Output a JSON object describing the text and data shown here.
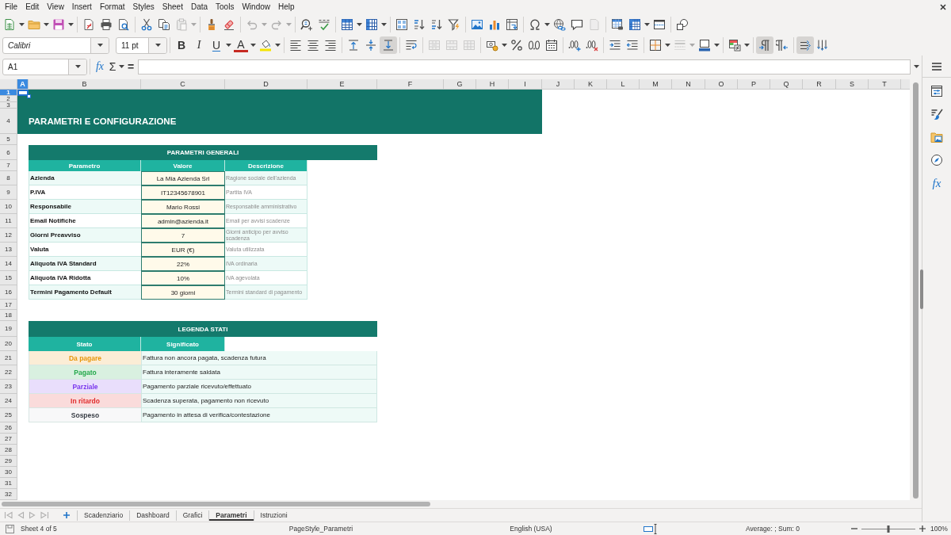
{
  "menu_bar": {
    "items": [
      "File",
      "Edit",
      "View",
      "Insert",
      "Format",
      "Styles",
      "Sheet",
      "Data",
      "Tools",
      "Window",
      "Help"
    ]
  },
  "standard_toolbar": {
    "groups": [
      {
        "items": [
          {
            "kind": "new",
            "disabled": false
          },
          {
            "kind": "caret",
            "disabled": false
          },
          {
            "kind": "open",
            "disabled": false
          },
          {
            "kind": "caret",
            "disabled": false
          },
          {
            "kind": "save",
            "disabled": false
          },
          {
            "kind": "caret",
            "disabled": false
          }
        ]
      },
      {
        "items": [
          {
            "kind": "export-pdf",
            "disabled": false
          },
          {
            "kind": "print",
            "disabled": false
          },
          {
            "kind": "print-preview",
            "disabled": false
          }
        ]
      },
      {
        "items": [
          {
            "kind": "cut",
            "disabled": false
          },
          {
            "kind": "copy",
            "disabled": false
          },
          {
            "kind": "paste",
            "disabled": true
          },
          {
            "kind": "caret",
            "disabled": true
          }
        ]
      },
      {
        "items": [
          {
            "kind": "clone-formatting",
            "disabled": false
          },
          {
            "kind": "clear-formatting",
            "disabled": false
          }
        ]
      },
      {
        "items": [
          {
            "kind": "undo",
            "disabled": true
          },
          {
            "kind": "caret",
            "disabled": true
          },
          {
            "kind": "redo",
            "disabled": true
          },
          {
            "kind": "caret",
            "disabled": true
          }
        ]
      },
      {
        "items": [
          {
            "kind": "find-replace",
            "disabled": false
          },
          {
            "kind": "spelling",
            "disabled": false
          }
        ]
      },
      {
        "items": [
          {
            "kind": "rows",
            "disabled": false
          },
          {
            "kind": "caret",
            "disabled": false
          },
          {
            "kind": "columns",
            "disabled": false
          },
          {
            "kind": "caret",
            "disabled": false
          }
        ]
      },
      {
        "items": [
          {
            "kind": "sort",
            "disabled": false
          },
          {
            "kind": "sort-ascending",
            "disabled": false
          },
          {
            "kind": "sort-descending",
            "disabled": false
          },
          {
            "kind": "autofilter",
            "disabled": false
          }
        ]
      },
      {
        "items": [
          {
            "kind": "image",
            "disabled": false
          },
          {
            "kind": "chart",
            "disabled": false
          },
          {
            "kind": "pivot-table",
            "disabled": false
          }
        ]
      },
      {
        "items": [
          {
            "kind": "special-character",
            "disabled": false
          },
          {
            "kind": "caret",
            "disabled": false
          },
          {
            "kind": "hyperlink",
            "disabled": false
          },
          {
            "kind": "comment",
            "disabled": false
          },
          {
            "kind": "header-footer",
            "disabled": true
          }
        ]
      },
      {
        "items": [
          {
            "kind": "print-area",
            "disabled": false
          },
          {
            "kind": "freeze",
            "disabled": false
          },
          {
            "kind": "caret",
            "disabled": false
          },
          {
            "kind": "split-window",
            "disabled": false
          }
        ]
      },
      {
        "items": [
          {
            "kind": "shapes",
            "disabled": false
          }
        ]
      }
    ]
  },
  "formatting_toolbar": {
    "font_name": "Calibri",
    "font_size": "11 pt",
    "groups": [
      {
        "items": [
          {
            "kind": "bold",
            "label": "B",
            "disabled": false,
            "pressed": false
          },
          {
            "kind": "italic",
            "label": "I",
            "disabled": false,
            "pressed": false
          },
          {
            "kind": "underline",
            "label": "U",
            "disabled": false,
            "pressed": false
          },
          {
            "kind": "caret",
            "disabled": false,
            "pressed": false
          },
          {
            "kind": "font-color",
            "label": "A",
            "disabled": false,
            "pressed": false
          },
          {
            "kind": "caret",
            "disabled": false,
            "pressed": false
          },
          {
            "kind": "highlight",
            "disabled": false,
            "pressed": false
          },
          {
            "kind": "caret",
            "disabled": false,
            "pressed": false
          }
        ]
      },
      {
        "items": [
          {
            "kind": "align-left",
            "disabled": false,
            "pressed": false
          },
          {
            "kind": "align-center",
            "disabled": false,
            "pressed": false
          },
          {
            "kind": "align-right",
            "disabled": false,
            "pressed": false
          }
        ]
      },
      {
        "items": [
          {
            "kind": "align-top",
            "disabled": false,
            "pressed": false
          },
          {
            "kind": "align-middle",
            "disabled": false,
            "pressed": false
          },
          {
            "kind": "align-bottom",
            "disabled": false,
            "pressed": true
          }
        ]
      },
      {
        "items": [
          {
            "kind": "wrap",
            "disabled": false,
            "pressed": false
          }
        ]
      },
      {
        "items": [
          {
            "kind": "merge-center",
            "disabled": true,
            "pressed": false
          },
          {
            "kind": "merge",
            "disabled": true,
            "pressed": false
          },
          {
            "kind": "unmerge",
            "disabled": true,
            "pressed": false
          }
        ]
      },
      {
        "items": [
          {
            "kind": "currency",
            "disabled": false,
            "pressed": false
          },
          {
            "kind": "caret",
            "disabled": false,
            "pressed": false
          },
          {
            "kind": "percent",
            "disabled": false,
            "pressed": false
          },
          {
            "kind": "number",
            "disabled": false,
            "pressed": false
          },
          {
            "kind": "date",
            "disabled": false,
            "pressed": false
          }
        ]
      },
      {
        "items": [
          {
            "kind": "add-decimal",
            "disabled": false,
            "pressed": false
          },
          {
            "kind": "delete-decimal",
            "disabled": false,
            "pressed": false
          }
        ]
      },
      {
        "items": [
          {
            "kind": "increase-indent",
            "disabled": false,
            "pressed": false
          },
          {
            "kind": "decrease-indent",
            "disabled": false,
            "pressed": false
          }
        ]
      },
      {
        "items": [
          {
            "kind": "borders",
            "disabled": false,
            "pressed": false
          },
          {
            "kind": "caret",
            "disabled": false,
            "pressed": false
          },
          {
            "kind": "border-style",
            "disabled": true,
            "pressed": false
          },
          {
            "kind": "caret",
            "disabled": true,
            "pressed": false
          },
          {
            "kind": "border-color",
            "disabled": false,
            "pressed": false
          },
          {
            "kind": "caret",
            "disabled": false,
            "pressed": false
          }
        ]
      },
      {
        "items": [
          {
            "kind": "conditional",
            "disabled": false,
            "pressed": false
          },
          {
            "kind": "caret",
            "disabled": false,
            "pressed": false
          }
        ]
      },
      {
        "items": [
          {
            "kind": "left-to-right",
            "disabled": false,
            "pressed": true
          },
          {
            "kind": "right-to-left",
            "disabled": false,
            "pressed": false
          }
        ]
      },
      {
        "items": [
          {
            "kind": "text-horizontal",
            "disabled": false,
            "pressed": true
          },
          {
            "kind": "text-vertical",
            "disabled": false,
            "pressed": false
          }
        ]
      }
    ]
  },
  "formula_bar": {
    "name_box": "A1",
    "buttons": [
      {
        "kind": "function-wizard",
        "label": "fx"
      },
      {
        "kind": "sum",
        "label": "Σ"
      },
      {
        "kind": "caret"
      },
      {
        "kind": "formula",
        "label": "="
      }
    ]
  },
  "sheet": {
    "columns": [
      {
        "label": "A",
        "selected": true
      },
      {
        "label": "B",
        "selected": false
      },
      {
        "label": "C",
        "selected": false
      },
      {
        "label": "D",
        "selected": false
      },
      {
        "label": "E",
        "selected": false
      },
      {
        "label": "F",
        "selected": false
      },
      {
        "label": "G",
        "selected": false
      },
      {
        "label": "H",
        "selected": false
      },
      {
        "label": "I",
        "selected": false
      },
      {
        "label": "J",
        "selected": false
      },
      {
        "label": "K",
        "selected": false
      },
      {
        "label": "L",
        "selected": false
      },
      {
        "label": "M",
        "selected": false
      },
      {
        "label": "N",
        "selected": false
      },
      {
        "label": "O",
        "selected": false
      },
      {
        "label": "P",
        "selected": false
      },
      {
        "label": "Q",
        "selected": false
      },
      {
        "label": "R",
        "selected": false
      },
      {
        "label": "S",
        "selected": false
      },
      {
        "label": "T",
        "selected": false
      }
    ],
    "rows": [
      {
        "label": "1",
        "selected": true
      },
      {
        "label": "2",
        "selected": false
      },
      {
        "label": "3",
        "selected": false
      },
      {
        "label": "4",
        "selected": false
      },
      {
        "label": "5",
        "selected": false
      },
      {
        "label": "6",
        "selected": false
      },
      {
        "label": "7",
        "selected": false
      },
      {
        "label": "8",
        "selected": false
      },
      {
        "label": "9",
        "selected": false
      },
      {
        "label": "10",
        "selected": false
      },
      {
        "label": "11",
        "selected": false
      },
      {
        "label": "12",
        "selected": false
      },
      {
        "label": "13",
        "selected": false
      },
      {
        "label": "14",
        "selected": false
      },
      {
        "label": "15",
        "selected": false
      },
      {
        "label": "16",
        "selected": false
      },
      {
        "label": "17",
        "selected": false
      },
      {
        "label": "18",
        "selected": false
      },
      {
        "label": "19",
        "selected": false
      },
      {
        "label": "20",
        "selected": false
      },
      {
        "label": "21",
        "selected": false
      },
      {
        "label": "22",
        "selected": false
      },
      {
        "label": "23",
        "selected": false
      },
      {
        "label": "24",
        "selected": false
      },
      {
        "label": "25",
        "selected": false
      },
      {
        "label": "26",
        "selected": false
      },
      {
        "label": "27",
        "selected": false
      },
      {
        "label": "28",
        "selected": false
      },
      {
        "label": "29",
        "selected": false
      },
      {
        "label": "30",
        "selected": false
      },
      {
        "label": "31",
        "selected": false
      },
      {
        "label": "32",
        "selected": false
      }
    ],
    "title": "PARAMETRI E CONFIGURAZIONE",
    "parameters": {
      "title": "PARAMETRI GENERALI",
      "header": [
        "Parametro",
        "Valore",
        "Descrizione"
      ],
      "rows": [
        {
          "parameter": "Azienda",
          "value": "La Mia Azienda Srl",
          "description": "Ragione sociale dell'azienda"
        },
        {
          "parameter": "P.IVA",
          "value": "IT12345678901",
          "description": "Partita IVA"
        },
        {
          "parameter": "Responsabile",
          "value": "Mario Rossi",
          "description": "Responsabile amministrativo"
        },
        {
          "parameter": "Email Notifiche",
          "value": "admin@azienda.it",
          "description": "Email per avvisi scadenze"
        },
        {
          "parameter": "Giorni Preavviso",
          "value": "7",
          "description": "Giorni anticipo per avviso scadenza"
        },
        {
          "parameter": "Valuta",
          "value": "EUR (€)",
          "description": "Valuta utilizzata"
        },
        {
          "parameter": "Aliquota IVA Standard",
          "value": "22%",
          "description": "IVA ordinaria"
        },
        {
          "parameter": "Aliquota IVA Ridotta",
          "value": "10%",
          "description": "IVA agevolata"
        },
        {
          "parameter": "Termini Pagamento Default",
          "value": "30 giorni",
          "description": "Termini standard di pagamento"
        }
      ]
    },
    "legend": {
      "title": "LEGENDA STATI",
      "header": [
        "Stato",
        "Significato"
      ],
      "rows": [
        {
          "status": "Da pagare",
          "color": "#e8960b",
          "meaning": "Fattura non ancora pagata, scadenza futura"
        },
        {
          "status": "Pagato",
          "color": "#22a84a",
          "meaning": "Fattura interamente saldata"
        },
        {
          "status": "Parziale",
          "color": "#7c3aed",
          "meaning": "Pagamento parziale ricevuto/effettuato"
        },
        {
          "status": "In ritardo",
          "color": "#e02d2d",
          "meaning": "Scadenza superata, pagamento non ricevuto"
        },
        {
          "status": "Sospeso",
          "color": "#3a3f47",
          "meaning": "Pagamento in attesa di verifica/contestazione"
        }
      ]
    }
  },
  "sheet_tabs": {
    "navigation": [
      {
        "kind": "first",
        "disabled": true
      },
      {
        "kind": "previous",
        "disabled": true
      },
      {
        "kind": "next",
        "disabled": true
      },
      {
        "kind": "last",
        "disabled": true
      }
    ],
    "tabs": [
      {
        "label": "Scadenziario",
        "selected": false
      },
      {
        "label": "Dashboard",
        "selected": false
      },
      {
        "label": "Grafici",
        "selected": false
      },
      {
        "label": "Parametri",
        "selected": true
      },
      {
        "label": "Istruzioni",
        "selected": false
      }
    ]
  },
  "sidebar": {
    "functions_label": "fx"
  },
  "status_bar": {
    "sheet": "Sheet 4 of 5",
    "page_style": "PageStyle_Parametri",
    "language": "English (USA)",
    "summary": "Average: ; Sum: 0",
    "zoom": {
      "level": 0.5,
      "reading": "100%"
    }
  }
}
